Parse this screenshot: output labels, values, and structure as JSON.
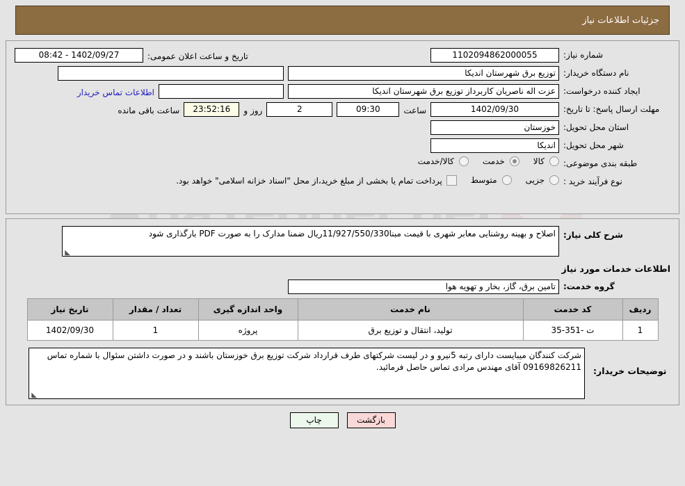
{
  "header": {
    "title": "جزئیات اطلاعات نیاز"
  },
  "colors": {
    "header_band": "#8c6c41",
    "header_text": "#ffffff",
    "link": "#2020c0",
    "countdown_bg": "#fbfbe8",
    "table_header_bg": "#c6c6c6",
    "print_button_bg": "#ecf8ec",
    "back_button_bg": "#fbd8d8",
    "page_bg": "#e4e4e4"
  },
  "watermark": {
    "text": "AriaTender.net"
  },
  "form": {
    "need_number": {
      "label": "شماره نیاز:",
      "value": "1102094862000055"
    },
    "public_announce": {
      "label": "تاریخ و ساعت اعلان عمومی:",
      "value": "1402/09/27 - 08:42"
    },
    "buyer_org": {
      "label": "نام دستگاه خریدار:",
      "value": "توزیع برق شهرستان اندیکا"
    },
    "buyer_org_extra": {
      "value": ""
    },
    "creator": {
      "label": "ایجاد کننده درخواست:",
      "value": "عزت اله ناصریان کاربرداز توزیع برق شهرستان اندیکا"
    },
    "contact_link": {
      "label": "اطلاعات تماس خریدار"
    },
    "deadline": {
      "label": "مهلت ارسال پاسخ: تا تاریخ:",
      "date": "1402/09/30",
      "time_label": "ساعت",
      "time": "09:30",
      "days": "2",
      "days_label": "روز و",
      "countdown": "23:52:16",
      "countdown_label": "ساعت باقی مانده"
    },
    "province": {
      "label": "استان محل تحویل:",
      "value": "خوزستان"
    },
    "city": {
      "label": "شهر محل تحویل:",
      "value": "اندیکا"
    },
    "category": {
      "label": "طبقه بندی موضوعی:",
      "options": [
        {
          "label": "کالا",
          "selected": false
        },
        {
          "label": "خدمت",
          "selected": true
        },
        {
          "label": "کالا/خدمت",
          "selected": false
        }
      ]
    },
    "purchase_type": {
      "label": "نوع فرآیند خرید :",
      "options": [
        {
          "label": "جزیی",
          "selected": false
        },
        {
          "label": "متوسط",
          "selected": false
        }
      ],
      "checkbox_label": "پرداخت تمام یا بخشی از مبلغ خرید،از محل \"اسناد خزانه اسلامی\" خواهد بود.",
      "checkbox_checked": false
    }
  },
  "description": {
    "label": "شرح کلی نیاز:",
    "value": "اصلاح و بهینه روشنایی معابر شهری با قیمت مبنا11/927/550/330ریال ضمنا مدارک را به صورت PDF بارگذاری شود"
  },
  "services_section": {
    "title": "اطلاعات خدمات مورد نیاز",
    "service_group": {
      "label": "گروه خدمت:",
      "value": "تامین برق، گاز، بخار و تهویه هوا"
    }
  },
  "table": {
    "columns": [
      "ردیف",
      "کد خدمت",
      "نام خدمت",
      "واحد اندازه گیری",
      "تعداد / مقدار",
      "تاریخ نیاز"
    ],
    "rows": [
      {
        "row_no": "1",
        "service_code": "ت -351-35",
        "service_name": "تولید، انتقال و توزیع برق",
        "unit": "پروژه",
        "quantity": "1",
        "need_date": "1402/09/30"
      }
    ]
  },
  "buyer_notes": {
    "label": "توضیحات خریدار:",
    "value": "شرکت کنندگان میبایست دارای رتبه 5نیرو و در لیست شرکتهای طرف قرارداد شرکت توزیع برق خوزستان باشند و در صورت داشتن سئوال با شماره تماس 09169826211 آقای مهندس مرادی تماس حاصل فرمائید."
  },
  "footer": {
    "print_button": "چاپ",
    "back_button": "بازگشت"
  }
}
